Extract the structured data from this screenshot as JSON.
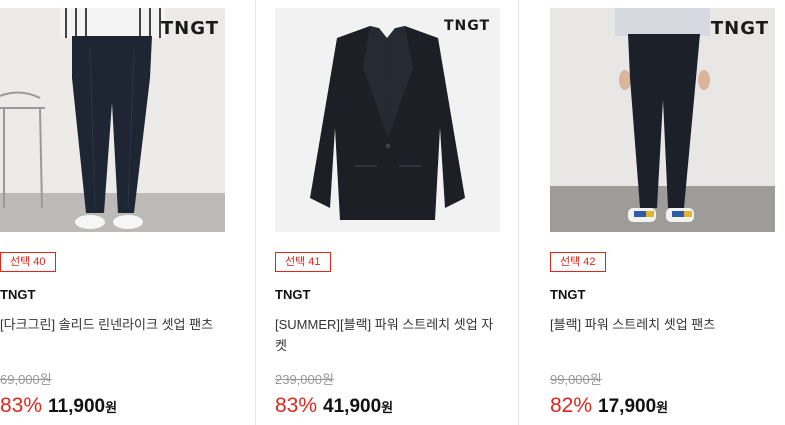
{
  "products": [
    {
      "brand_mark": "TNGT",
      "badge": "선택 40",
      "brand": "TNGT",
      "title": "[다크그린] 솔리드 린넨라이크 셋업 팬츠",
      "original_price": "69,000원",
      "discount": "83%",
      "price": "11,900",
      "currency": "원",
      "image": "dark-green-pants-model-photo"
    },
    {
      "brand_mark": "TNGT",
      "badge": "선택 41",
      "brand": "TNGT",
      "title": "[SUMMER][블랙] 파워 스트레치 셋업 자켓",
      "original_price": "239,000원",
      "discount": "83%",
      "price": "41,900",
      "currency": "원",
      "image": "black-suit-jacket-photo"
    },
    {
      "brand_mark": "TNGT",
      "badge": "선택 42",
      "brand": "TNGT",
      "title": "[블랙] 파워 스트레치 셋업 팬츠",
      "original_price": "99,000원",
      "discount": "82%",
      "price": "17,900",
      "currency": "원",
      "image": "black-pants-model-photo"
    }
  ],
  "colors": {
    "accent": "#e1251b",
    "muted": "#999999",
    "text": "#111111"
  }
}
